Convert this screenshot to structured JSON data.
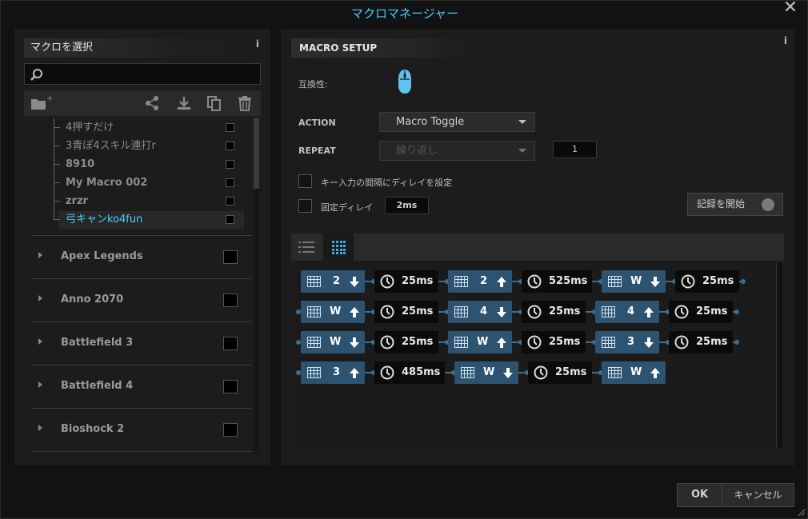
{
  "window": {
    "title": "マクロマネージャー",
    "close_label": "✕"
  },
  "left": {
    "header": "マクロを選択",
    "info": "i",
    "search": {
      "placeholder": ""
    },
    "toolbar_icons": [
      "folder-add-icon",
      "share-icon",
      "download-icon",
      "copy-icon",
      "trash-icon"
    ],
    "macros": [
      {
        "label": "4押すだけ",
        "selected": false
      },
      {
        "label": "3青ぽ4スキル連打r",
        "selected": false
      },
      {
        "label": "8910",
        "selected": false
      },
      {
        "label": "My Macro 002",
        "selected": false
      },
      {
        "label": "zrzr",
        "selected": false
      },
      {
        "label": "弓キャンko4fun",
        "selected": true
      }
    ],
    "games": [
      "Apex Legends",
      "Anno 2070",
      "Battlefield 3",
      "Battlefield 4",
      "Bioshock 2"
    ]
  },
  "right": {
    "header": "MACRO SETUP",
    "info": "i",
    "compat_label": "互換性:",
    "action_label": "ACTION",
    "action_value": "Macro Toggle",
    "repeat_label": "REPEAT",
    "repeat_value": "繰り返し",
    "repeat_count": "1",
    "delay_checkbox_label": "キー入力の間隔にディレイを設定",
    "fixed_delay_label": "固定ディレイ",
    "fixed_delay_value": "2ms",
    "record_button": "記録を開始",
    "sequence": [
      [
        {
          "t": "key",
          "k": "2",
          "d": "down"
        },
        {
          "t": "delay",
          "v": "25ms"
        },
        {
          "t": "key",
          "k": "2",
          "d": "up"
        },
        {
          "t": "delay",
          "v": "525ms"
        },
        {
          "t": "key",
          "k": "W",
          "d": "down"
        },
        {
          "t": "delay",
          "v": "25ms"
        }
      ],
      [
        {
          "t": "key",
          "k": "W",
          "d": "up"
        },
        {
          "t": "delay",
          "v": "25ms"
        },
        {
          "t": "key",
          "k": "4",
          "d": "down"
        },
        {
          "t": "delay",
          "v": "25ms"
        },
        {
          "t": "key",
          "k": "4",
          "d": "up"
        },
        {
          "t": "delay",
          "v": "25ms"
        }
      ],
      [
        {
          "t": "key",
          "k": "W",
          "d": "down"
        },
        {
          "t": "delay",
          "v": "25ms"
        },
        {
          "t": "key",
          "k": "W",
          "d": "up"
        },
        {
          "t": "delay",
          "v": "25ms"
        },
        {
          "t": "key",
          "k": "3",
          "d": "down"
        },
        {
          "t": "delay",
          "v": "25ms"
        }
      ],
      [
        {
          "t": "key",
          "k": "3",
          "d": "up"
        },
        {
          "t": "delay",
          "v": "485ms"
        },
        {
          "t": "key",
          "k": "W",
          "d": "down"
        },
        {
          "t": "delay",
          "v": "25ms"
        },
        {
          "t": "key",
          "k": "W",
          "d": "up"
        }
      ]
    ]
  },
  "footer": {
    "ok": "OK",
    "cancel": "キャンセル"
  }
}
